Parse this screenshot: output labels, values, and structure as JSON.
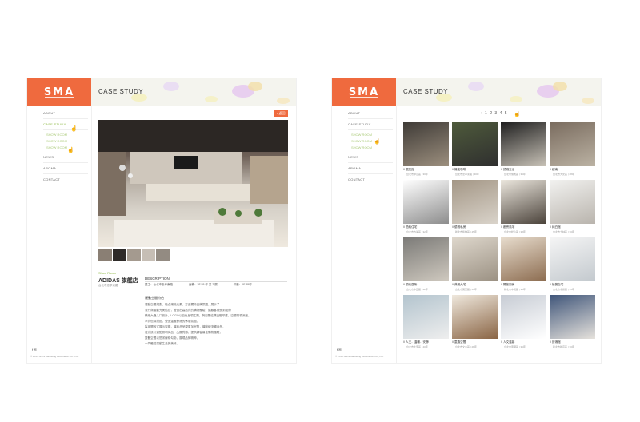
{
  "left_page": {
    "logo": "SMA",
    "banner_title": "CASE STUDY",
    "nav": [
      "ABOUT",
      "CASE STUDY",
      "NEWS",
      "AROMA",
      "CONTACT"
    ],
    "sub_nav": [
      "SHOW ROOM",
      "SHOW ROOM",
      "SHOW ROOM"
    ],
    "badge": "• 返回",
    "category": "Show Room",
    "project_title": "ADIDAS 旗艦店",
    "project_location": "台北市忠孝東路",
    "description_heading": "DESCRIPTION",
    "meta": [
      "屋主：台北市忠孝東路",
      "面積：2F 55 坪 共 2 層",
      "坪數：1F 55坪"
    ],
    "text_heading": "運動空間特色",
    "text_lines": [
      "運動空間規劃，融合潮流元素，打造獨特品牌氛圍，展示了",
      "流行與運動完美結合，營造出高品質的購物體驗，讓顧客感受到品牌",
      "精緻大器入口設計，LOGO以白色呈現主題，與空間結構交融呼應，空間再現深度，",
      "木質色調搭配，營造溫暖舒適的休憩氛圍，",
      "採用開放式展示架構，讓商品呈現更加完整，讓動線流暢自然，",
      "燈光設計重點照明商品，凸顯質感，提供顧客最佳購物體驗，",
      "整體空間以簡潔線條勾勒，展現品牌精神，",
      "一同體驗運動生活的美好。"
    ],
    "social": "f  ✉",
    "copyright": "© 2014 Scent Marketing Association Co., Ltd."
  },
  "right_page": {
    "logo": "SMA",
    "banner_title": "CASE STUDY",
    "nav": [
      "ABOUT",
      "CASE STUDY",
      "NEWS",
      "AROMA",
      "CONTACT"
    ],
    "sub_nav": [
      "SHOW ROOM",
      "SHOW ROOM",
      "SHOW ROOM"
    ],
    "pager": "‹ 1 2 3 4 5 ›",
    "social": "f  ✉",
    "copyright": "© 2014 Scent Marketing Association Co., Ltd.",
    "tiles": [
      {
        "cap": "// 銀座館",
        "loc": "台北市中山區 | 30坪",
        "c1": "#3f3b37",
        "c2": "#9c8f7e"
      },
      {
        "cap": "// 機能咖啡",
        "loc": "台北市忠孝東路 | 40坪",
        "c1": "#4e5a3b",
        "c2": "#2f2f2f"
      },
      {
        "cap": "// 舒適生活",
        "loc": "台北市信義區 | 35坪",
        "c1": "#1f1f1f",
        "c2": "#c8c2b7"
      },
      {
        "cap": "// 越南",
        "loc": "台北市大安區 | 28坪",
        "c1": "#7a6c5f",
        "c2": "#bbb2a3"
      },
      {
        "cap": "// 簡約住宅",
        "loc": "台北市內湖區 | 32坪",
        "c1": "#ffffff",
        "c2": "#8d8d8d"
      },
      {
        "cap": "// 優雅私房",
        "loc": "新北市板橋區 | 45坪",
        "c1": "#a39685",
        "c2": "#d9d3ca"
      },
      {
        "cap": "// 都會風宅",
        "loc": "台北市松山區 | 38坪",
        "c1": "#ece7de",
        "c2": "#4b433b"
      },
      {
        "cap": "// 純白館",
        "loc": "台北市士林區 | 30坪",
        "c1": "#f2f2f0",
        "c2": "#b9b4ad"
      },
      {
        "cap": "// 現代居所",
        "loc": "台北市中正區 | 42坪",
        "c1": "#7c7b78",
        "c2": "#cfc9bf"
      },
      {
        "cap": "// 典雅大宅",
        "loc": "台北市萬華區 | 50坪",
        "c1": "#ded7cc",
        "c2": "#9b9183"
      },
      {
        "cap": "// 開放廚房",
        "loc": "新北市中和區 | 36坪",
        "c1": "#e7dccd",
        "c2": "#8c6c50"
      },
      {
        "cap": "// 極簡白宅",
        "loc": "台北市北投區 | 33坪",
        "c1": "#f5f5f5",
        "c2": "#c3c9ce"
      },
      {
        "cap": "// 人文．溫暖．安靜",
        "loc": "台北市大安區 | 40坪",
        "c1": "#b3c4ce",
        "c2": "#eeeeee"
      },
      {
        "cap": "// 童趣空間",
        "loc": "台北市文山區 | 28坪",
        "c1": "#efe8dd",
        "c2": "#8a6545"
      },
      {
        "cap": "// 人文溫馨",
        "loc": "台北市南港區 | 35坪",
        "c1": "#c7ccd4",
        "c2": "#ffffff"
      },
      {
        "cap": "// 舒適館",
        "loc": "新北市新店區 | 30坪",
        "c1": "#40567a",
        "c2": "#e6e2dc"
      }
    ]
  }
}
